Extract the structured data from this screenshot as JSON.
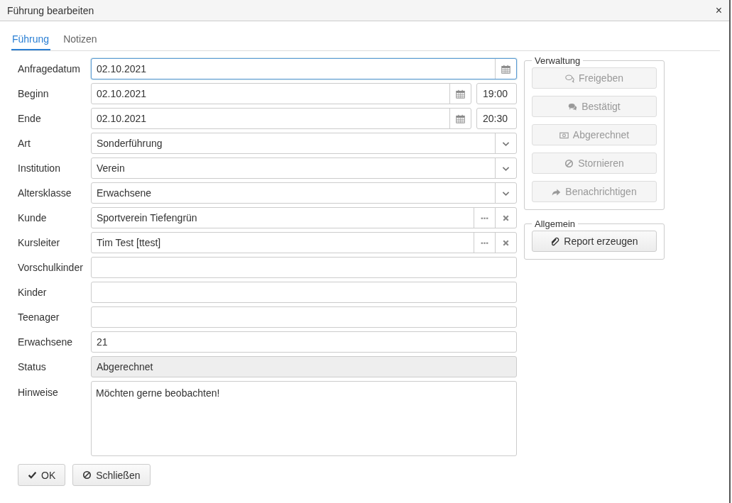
{
  "window": {
    "title": "Führung bearbeiten",
    "close": "×"
  },
  "tabs": [
    {
      "label": "Führung",
      "selected": true
    },
    {
      "label": "Notizen",
      "selected": false
    }
  ],
  "fields": [
    {
      "label": "Anfragedatum",
      "kind": "date",
      "value": "02.10.2021",
      "focused": true
    },
    {
      "label": "Beginn",
      "kind": "datetime",
      "value": "02.10.2021",
      "time": "19:00",
      "focused": false
    },
    {
      "label": "Ende",
      "kind": "datetime",
      "value": "02.10.2021",
      "time": "20:30",
      "focused": false
    },
    {
      "label": "Art",
      "kind": "select",
      "value": "Sonderführung",
      "focused": false
    },
    {
      "label": "Institution",
      "kind": "select",
      "value": "Verein",
      "focused": false
    },
    {
      "label": "Altersklasse",
      "kind": "select",
      "value": "Erwachsene",
      "focused": false
    },
    {
      "label": "Kunde",
      "kind": "lookup",
      "value": "Sportverein Tiefengrün",
      "focused": false
    },
    {
      "label": "Kursleiter",
      "kind": "lookup",
      "value": "Tim Test [ttest]",
      "focused": false
    },
    {
      "label": "Vorschulkinder",
      "kind": "text",
      "focused": false
    },
    {
      "label": "Kinder",
      "kind": "text",
      "focused": false
    },
    {
      "label": "Teenager",
      "kind": "text",
      "focused": false
    },
    {
      "label": "Erwachsene",
      "kind": "text",
      "value": "21",
      "focused": false
    },
    {
      "label": "Status",
      "kind": "readonly",
      "value": "Abgerechnet",
      "focused": false
    },
    {
      "label": "Hinweise",
      "kind": "textarea",
      "value": "Möchten gerne beobachten!",
      "focused": false
    }
  ],
  "groups": [
    {
      "legend": "Verwaltung",
      "buttons": [
        {
          "label": "Freigeben",
          "disabled": true
        },
        {
          "label": "Bestätigt",
          "disabled": true
        },
        {
          "label": "Abgerechnet",
          "disabled": true
        },
        {
          "label": "Stornieren",
          "disabled": true
        },
        {
          "label": "Benachrichtigen",
          "disabled": true
        }
      ]
    },
    {
      "legend": "Allgemein",
      "buttons": [
        {
          "label": "Report erzeugen",
          "disabled": false
        }
      ]
    }
  ],
  "footer_buttons": [
    {
      "label": "OK"
    },
    {
      "label": "Schließen"
    }
  ]
}
